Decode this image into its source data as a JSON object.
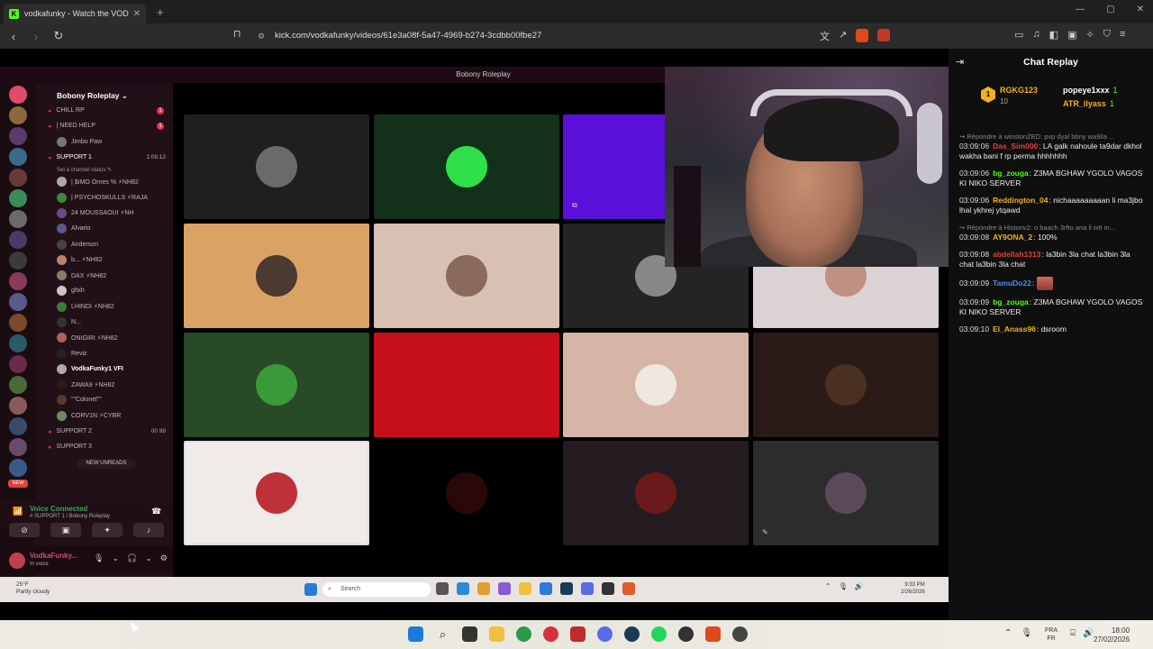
{
  "browser": {
    "tab_title": "vodkafunky - Watch the VOD",
    "url": "kick.com/vodkafunky/videos/61e3a08f-5a47-4969-b274-3cdbb00fbe27"
  },
  "discord": {
    "window_title": "Bobony Roleplay",
    "server_name": "Bobony Roleplay",
    "channels": [
      {
        "label": "CHILL RP",
        "kind": "voice",
        "badge": "1"
      },
      {
        "label": "| NEED HELP",
        "kind": "voice",
        "badge": "1"
      },
      {
        "label": "Jimbo Paw",
        "kind": "member"
      },
      {
        "label": "SUPPORT 1",
        "kind": "voice",
        "timer": "1:08:12"
      },
      {
        "label": "Set a channel status ✎",
        "kind": "status"
      },
      {
        "label": "| $IMO Ornes % ⚡NH82",
        "kind": "member"
      },
      {
        "label": "| PSYCHOSKULLS ⚡RAJA",
        "kind": "member"
      },
      {
        "label": "24 MOUSSAOUI ⚡NH",
        "kind": "member"
      },
      {
        "label": "Alvario",
        "kind": "member"
      },
      {
        "label": "Anderson",
        "kind": "member"
      },
      {
        "label": "b... ⚡NH82",
        "kind": "member"
      },
      {
        "label": "DAX ⚡NH82",
        "kind": "member"
      },
      {
        "label": "gltxh",
        "kind": "member"
      },
      {
        "label": "LHINDI ⚡NH82",
        "kind": "member"
      },
      {
        "label": "N...",
        "kind": "member"
      },
      {
        "label": "ONIGIRI ⚡NH82",
        "kind": "member"
      },
      {
        "label": "Reviz",
        "kind": "member"
      },
      {
        "label": "VodkaFunky1 VFI",
        "kind": "member"
      },
      {
        "label": "ZAWA9 ⚡NH82",
        "kind": "member"
      },
      {
        "label": "\"\"Colonel\"\"",
        "kind": "member"
      },
      {
        "label": "CORV1N ⚡CYBR",
        "kind": "member"
      },
      {
        "label": "SUPPORT 2",
        "kind": "voice",
        "timer": "00  99"
      },
      {
        "label": "SUPPORT 3",
        "kind": "voice"
      }
    ],
    "new_unreads": "NEW UNREADS",
    "voice_connected": "Voice Connected",
    "voice_channel": "# SUPPORT 1 / Bobony Roleplay",
    "username": "VodkaFunky...",
    "user_status": "In voice",
    "new_badge": "NEW"
  },
  "inner_taskbar": {
    "weather_temp": "25°F",
    "weather_desc": "Partly cloudy",
    "search_placeholder": "Search",
    "time": "9:33 PM",
    "date": "2/26/2026"
  },
  "chat": {
    "title": "Chat Replay",
    "top_gifters": [
      {
        "name": "RGKG123",
        "count": "10",
        "rank": "1"
      },
      {
        "name": "popeye1xxx",
        "count": "1"
      },
      {
        "name": "ATR_ilyass",
        "count": "1"
      }
    ],
    "messages": [
      {
        "reply": "↪ Répondre à winstonZED: pvp dyal bbny wa9ila ...",
        "time": "03:09:06",
        "user": "Das_Sim000",
        "color": "#e0413a",
        "text": "LA galk nahoule ta9dar dkhol wakha bani f rp perma hhhhhhh"
      },
      {
        "time": "03:09:06",
        "user": "bg_zouga",
        "color": "#53fc18",
        "text": "Z3MA BGHAW YGOLO VAGOS KI NIKO SERVER"
      },
      {
        "time": "03:09:06",
        "user": "Reddington_04",
        "color": "#f2b21e",
        "text": "nichaaaaaaaaan li ma3jbo lhal ykhrej ytqawd"
      },
      {
        "reply": "↪ Répondre à Histonv2: o baach 3rfto ana li w9 m...",
        "time": "03:09:08",
        "user": "AY9ONA_2",
        "color": "#f2b21e",
        "text": "100%"
      },
      {
        "time": "03:09:08",
        "user": "abdellah1313",
        "color": "#e0413a",
        "text": "la3bin 3la chat la3bin 3la chat la3bin 3la chat"
      },
      {
        "time": "03:09:09",
        "user": "TamuDo22",
        "color": "#4a8cf0",
        "text": ""
      },
      {
        "time": "03:09:09",
        "user": "bg_zouga",
        "color": "#53fc18",
        "text": "Z3MA BGHAW YGOLO VAGOS KI NIKO SERVER"
      },
      {
        "time": "03:09:10",
        "user": "El_Anass96",
        "color": "#f2b21e",
        "text": "dsroom"
      }
    ]
  },
  "taskbar": {
    "lang_top": "FRA",
    "lang_bottom": "FR",
    "time": "18:00",
    "date": "27/02/2026"
  }
}
